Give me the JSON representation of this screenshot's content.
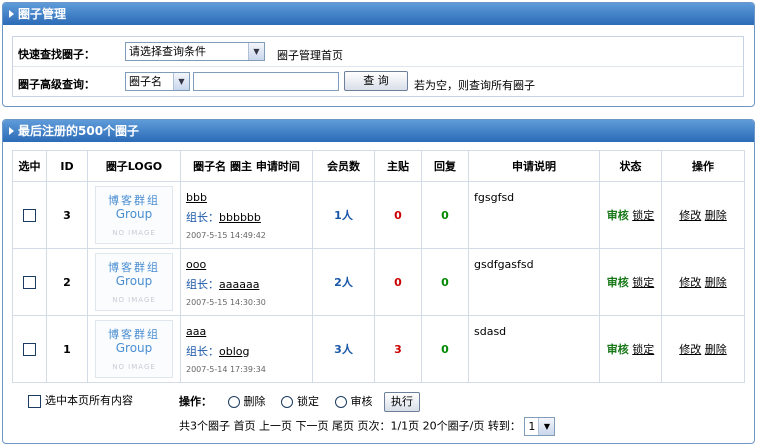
{
  "panel_top": {
    "title": "圈子管理",
    "quick_find_label": "快速查找圈子：",
    "quick_find_select": "请选择查询条件",
    "home_link": "圈子管理首页",
    "adv_label": "圈子高级查询：",
    "adv_field_select": "圈子名",
    "adv_input_value": "",
    "search_button": "查 询",
    "hint": "若为空，则查询所有圈子"
  },
  "panel_list": {
    "title": "最后注册的500个圈子",
    "headers": [
      "选中",
      "ID",
      "圈子LOGO",
      "圈子名  圈主  申请时间",
      "会员数",
      "主贴",
      "回复",
      "申请说明",
      "状态",
      "操作"
    ],
    "logo": {
      "line1": "博客群组",
      "line2": "Group",
      "line3": "NO IMAGE"
    },
    "leader_label": "组长：",
    "rows": [
      {
        "id": "3",
        "name": "bbb",
        "leader": "bbbbbb",
        "time": "2007-5-15 14:49:42",
        "members": "1人",
        "posts": "0",
        "replies": "0",
        "desc": "fgsgfsd",
        "status": "审核",
        "lock": "锁定",
        "edit": "修改",
        "del": "删除",
        "posts_color": "#cc0000"
      },
      {
        "id": "2",
        "name": "ooo",
        "leader": "aaaaaa",
        "time": "2007-5-15 14:30:30",
        "members": "2人",
        "posts": "0",
        "replies": "0",
        "desc": "gsdfgasfsd",
        "status": "审核",
        "lock": "锁定",
        "edit": "修改",
        "del": "删除",
        "posts_color": "#cc0000"
      },
      {
        "id": "1",
        "name": "aaa",
        "leader": "oblog",
        "time": "2007-5-14 17:39:34",
        "members": "3人",
        "posts": "3",
        "replies": "0",
        "desc": "sdasd",
        "status": "审核",
        "lock": "锁定",
        "edit": "修改",
        "del": "删除",
        "posts_color": "#cc0000"
      }
    ],
    "select_all_label": "选中本页所有内容",
    "ops_label": "操作：",
    "op_delete": "删除",
    "op_lock": "锁定",
    "op_audit": "审核",
    "exec_button": "执行",
    "pager_text": "共3个圈子  首页  上一页 下一页  尾页 页次：1/1页   20个圈子/页 转到：",
    "page_select": "1"
  }
}
